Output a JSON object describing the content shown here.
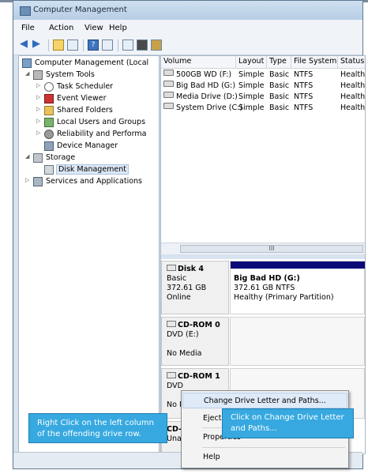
{
  "window": {
    "title": "Computer Management"
  },
  "menubar": {
    "items": [
      "File",
      "Action",
      "View",
      "Help"
    ]
  },
  "tree": {
    "items": [
      {
        "label": "Computer Management (Local",
        "level": 0,
        "icon": "computer-icon"
      },
      {
        "label": "System Tools",
        "level": 1,
        "icon": "tools-icon"
      },
      {
        "label": "Task Scheduler",
        "level": 2,
        "icon": "clock-icon"
      },
      {
        "label": "Event Viewer",
        "level": 2,
        "icon": "event-viewer-icon"
      },
      {
        "label": "Shared Folders",
        "level": 2,
        "icon": "shared-folder-icon"
      },
      {
        "label": "Local Users and Groups",
        "level": 2,
        "icon": "users-icon"
      },
      {
        "label": "Reliability and Performa",
        "level": 2,
        "icon": "performance-icon"
      },
      {
        "label": "Device Manager",
        "level": 2,
        "icon": "device-manager-icon"
      },
      {
        "label": "Storage",
        "level": 1,
        "icon": "storage-icon"
      },
      {
        "label": "Disk Management",
        "level": 2,
        "icon": "disk-icon",
        "selected": true
      },
      {
        "label": "Services and Applications",
        "level": 1,
        "icon": "services-icon"
      }
    ]
  },
  "volumes": {
    "columns": [
      "Volume",
      "Layout",
      "Type",
      "File System",
      "Status"
    ],
    "rows": [
      [
        "500GB WD (F:)",
        "Simple",
        "Basic",
        "NTFS",
        "Healthy (P"
      ],
      [
        "Big Bad HD (G:)",
        "Simple",
        "Basic",
        "NTFS",
        "Healthy (P"
      ],
      [
        "Media Drive (D:)",
        "Simple",
        "Basic",
        "NTFS",
        "Healthy (A"
      ],
      [
        "System Drive (C:)",
        "Simple",
        "Basic",
        "NTFS",
        "Healthy (S"
      ]
    ],
    "scroll_label": "III"
  },
  "disks": [
    {
      "name": "Disk 4",
      "lines": [
        "Basic",
        "372.61 GB",
        "Online"
      ],
      "partition": {
        "name": "Big Bad HD  (G:)",
        "lines": [
          "372.61 GB NTFS",
          "Healthy (Primary Partition)"
        ]
      }
    },
    {
      "name": "CD-ROM 0",
      "lines": [
        "DVD (E:)",
        "",
        "No Media"
      ]
    },
    {
      "name": "CD-ROM 1",
      "lines": [
        "DVD",
        "",
        "No Med"
      ]
    },
    {
      "name": "CD-I",
      "lines": [
        "Unallo"
      ]
    }
  ],
  "context_menu": {
    "items": [
      "Change Drive Letter and Paths...",
      "Eject",
      "Properties",
      "Help"
    ],
    "highlighted": 0
  },
  "callouts": {
    "left": "Right Click on the left column of the offending drive row.",
    "right": "Click on Change Drive Letter and Paths..."
  },
  "colors": {
    "accent": "#37a9e0",
    "partition_bar": "#0a0a78",
    "window_frame": "#d7e3ef"
  }
}
